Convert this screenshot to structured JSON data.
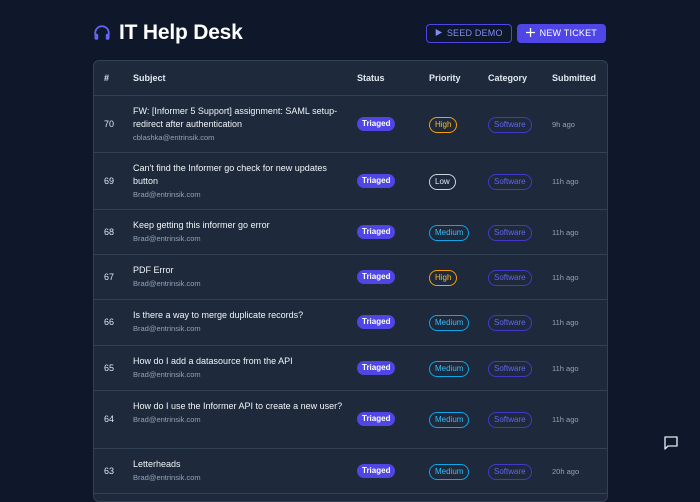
{
  "app": {
    "title": "IT Help Desk"
  },
  "header": {
    "seed_label": "SEED DEMO",
    "new_label": "NEW TICKET"
  },
  "table": {
    "columns": [
      "#",
      "Subject",
      "Status",
      "Priority",
      "Category",
      "Submitted"
    ],
    "rows": [
      {
        "id": "70",
        "subject": "FW: [Informer 5 Support] assignment: SAML setup- redirect after authentication",
        "email": "cblashka@entrinsik.com",
        "status": "Triaged",
        "priority": "High",
        "category": "Software",
        "submitted": "9h ago"
      },
      {
        "id": "69",
        "subject": "Can't find the Informer go check for new updates button",
        "email": "Brad@entrinsik.com",
        "status": "Triaged",
        "priority": "Low",
        "category": "Software",
        "submitted": "11h ago"
      },
      {
        "id": "68",
        "subject": "Keep getting this informer go error",
        "email": "Brad@entrinsik.com",
        "status": "Triaged",
        "priority": "Medium",
        "category": "Software",
        "submitted": "11h ago"
      },
      {
        "id": "67",
        "subject": "PDF Error",
        "email": "Brad@entrinsik.com",
        "status": "Triaged",
        "priority": "High",
        "category": "Software",
        "submitted": "11h ago"
      },
      {
        "id": "66",
        "subject": "Is there a way to merge duplicate records?",
        "email": "Brad@entrinsik.com",
        "status": "Triaged",
        "priority": "Medium",
        "category": "Software",
        "submitted": "11h ago"
      },
      {
        "id": "65",
        "subject": "How do I add a datasource from the API",
        "email": "Brad@entrinsik.com",
        "status": "Triaged",
        "priority": "Medium",
        "category": "Software",
        "submitted": "11h ago"
      },
      {
        "id": "64",
        "subject": "How do I use the Informer API to create a new user?",
        "email": "Brad@entrinsik.com",
        "status": "Triaged",
        "priority": "Medium",
        "category": "Software",
        "submitted": "11h ago"
      },
      {
        "id": "63",
        "subject": "Letterheads",
        "email": "Brad@entrinsik.com",
        "status": "Triaged",
        "priority": "Medium",
        "category": "Software",
        "submitted": "20h ago"
      }
    ]
  },
  "icons": {
    "logo": "headset-icon",
    "seed": "play-icon",
    "new": "plus-icon",
    "chat": "chat-icon"
  },
  "colors": {
    "accent": "#4f46e5",
    "background": "#0f172a",
    "card": "#1e293b"
  }
}
